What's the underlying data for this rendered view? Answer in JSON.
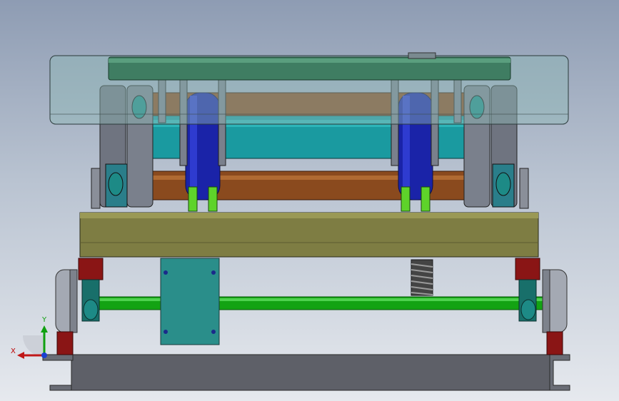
{
  "viewport": {
    "background_top": "#8e9cb3",
    "background_bottom": "#e6e9ee"
  },
  "triad": {
    "x_label": "X",
    "y_label": "Y",
    "x_color": "#c01818",
    "y_color": "#10a010",
    "z_color": "#1a3fd0"
  },
  "model_colors": {
    "top_panel_glass": "#8fb8b5",
    "top_plate": "#3f7d62",
    "teal_frame": "#1a9aa0",
    "cylinder": "#1a23a8",
    "cylinder_clevis": "#5ed32a",
    "brown_bar": "#8a4a1e",
    "linkage_gray": "#6f7480",
    "base_block": "#7e7d43",
    "axle": "#13a313",
    "wheel": "#9aa0ab",
    "red_bearing": "#8a1515",
    "spring": "#4b4b4b",
    "center_plate": "#2a8e8a",
    "rail": "#5e6068"
  }
}
